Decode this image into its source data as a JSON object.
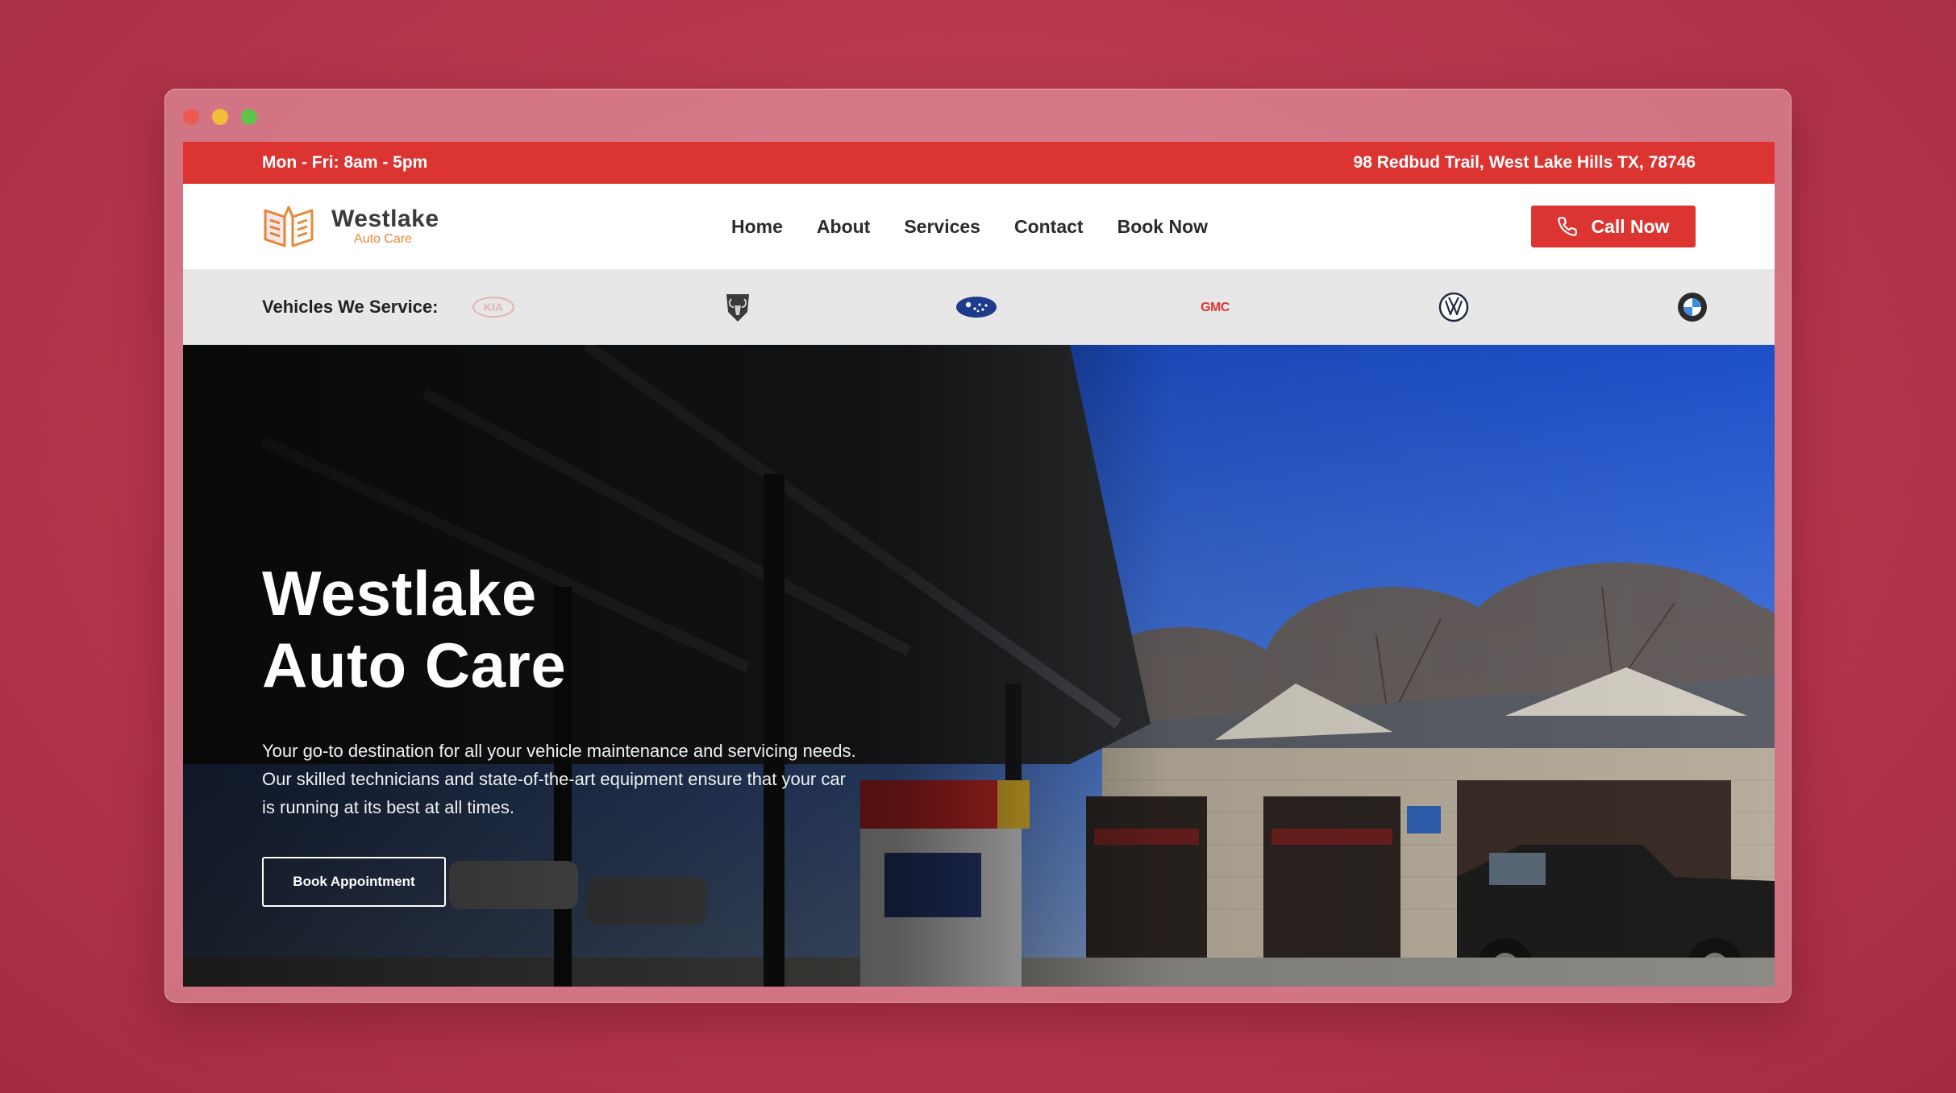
{
  "topbar": {
    "hours": "Mon - Fri: 8am - 5pm",
    "address": "98 Redbud Trail, West Lake Hills TX, 78746"
  },
  "logo": {
    "name": "Westlake",
    "tagline": "Auto Care"
  },
  "nav": {
    "items": [
      {
        "label": "Home"
      },
      {
        "label": "About"
      },
      {
        "label": "Services"
      },
      {
        "label": "Contact"
      },
      {
        "label": "Book Now"
      }
    ],
    "call_label": "Call Now"
  },
  "brands": {
    "title": "Vehicles We Service:",
    "logos": [
      {
        "name": "kia-logo",
        "text": "KIA"
      },
      {
        "name": "ram-logo",
        "text": ""
      },
      {
        "name": "subaru-logo",
        "text": ""
      },
      {
        "name": "gmc-logo",
        "text": "GMC"
      },
      {
        "name": "volkswagen-logo",
        "text": ""
      },
      {
        "name": "bmw-logo",
        "text": ""
      }
    ]
  },
  "hero": {
    "title_line1": "Westlake",
    "title_line2": "Auto Care",
    "description": "Your go-to destination for all your vehicle maintenance and servicing needs. Our skilled technicians and state-of-the-art equipment ensure that your car is running at its best at all times.",
    "button_label": "Book Appointment"
  },
  "colors": {
    "accent": "#dc3431",
    "logo_orange": "#e8893a",
    "background": "#b8384d"
  }
}
